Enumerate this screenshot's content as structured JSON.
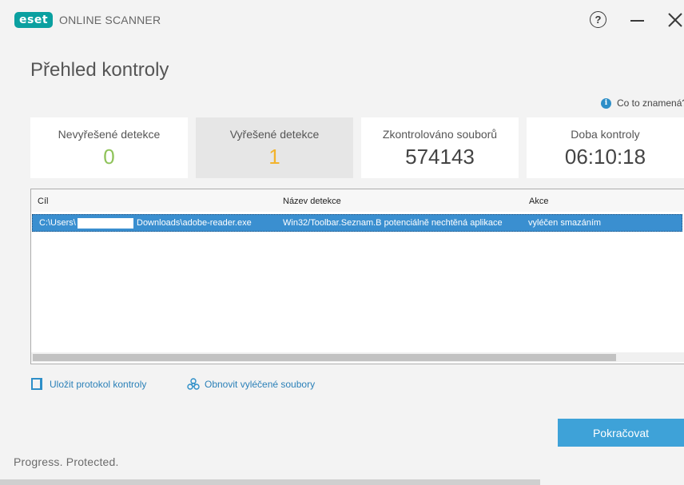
{
  "app": {
    "logo_text": "eset",
    "title": "ONLINE SCANNER"
  },
  "page": {
    "title": "Přehled kontroly",
    "info_link": "Co to znamená?"
  },
  "stats": [
    {
      "label": "Nevyřešené detekce",
      "value": "0",
      "color": "#8fc35a"
    },
    {
      "label": "Vyřešené detekce",
      "value": "1",
      "color": "#f2b32c"
    },
    {
      "label": "Zkontrolováno souborů",
      "value": "574143"
    },
    {
      "label": "Doba kontroly",
      "value": "06:10:18"
    }
  ],
  "table": {
    "columns": [
      "Cíl",
      "Název detekce",
      "Akce"
    ],
    "rows": [
      {
        "target_prefix": "C:\\Users\\",
        "target_suffix": "Downloads\\adobe-reader.exe",
        "detection": "Win32/Toolbar.Seznam.B potenciálně nechtěná aplikace",
        "action": "vyléčen smazáním"
      }
    ]
  },
  "actions": {
    "save_log": "Uložit protokol kontroly",
    "restore": "Obnovit vyléčené soubory",
    "continue": "Pokračovat"
  },
  "footer": {
    "tagline": "Progress. Protected."
  },
  "colors": {
    "accent": "#3ea2d8",
    "selected_row": "#3a8fd0",
    "brand": "#0aa0a0"
  }
}
